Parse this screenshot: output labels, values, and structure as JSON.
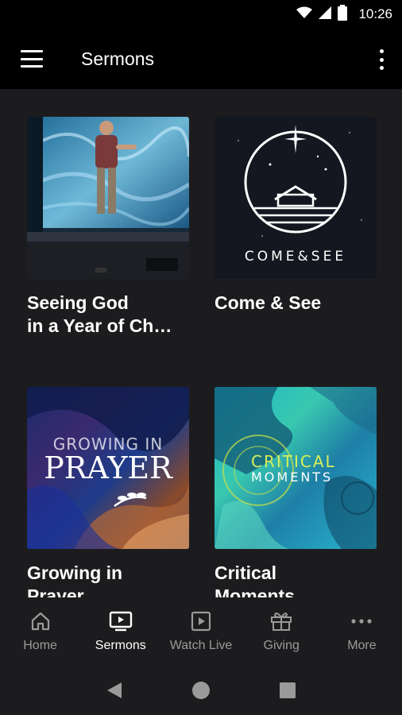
{
  "status_bar": {
    "time": "10:26",
    "icons": [
      "wifi-icon",
      "signal-icon",
      "battery-icon"
    ]
  },
  "app_bar": {
    "title": "Sermons",
    "menu_icon": "hamburger-menu-icon",
    "overflow_icon": "more-vertical-icon"
  },
  "sermons": [
    {
      "title": "Seeing God in a Year of Ch…",
      "title_line1": "Seeing God",
      "title_line2": "in a Year of Ch…"
    },
    {
      "title": "Come & See",
      "title_line1": "Come & See",
      "title_line2": "",
      "artwork_text": "COME&SEE"
    },
    {
      "title": "Growing in Prayer",
      "title_line1": "Growing in",
      "title_line2": "Prayer",
      "artwork_text_top": "GROWING IN",
      "artwork_text_main": "PRAYER"
    },
    {
      "title": "Critical Moments",
      "title_line1": "Critical",
      "title_line2": "Moments",
      "artwork_text_top": "CRITICAL",
      "artwork_text_bottom": "MOMENTS"
    }
  ],
  "bottom_nav": {
    "items": [
      {
        "label": "Home",
        "icon": "home-icon",
        "active": false
      },
      {
        "label": "Sermons",
        "icon": "tv-icon",
        "active": true
      },
      {
        "label": "Watch Live",
        "icon": "play-square-icon",
        "active": false
      },
      {
        "label": "Giving",
        "icon": "gift-icon",
        "active": false
      },
      {
        "label": "More",
        "icon": "more-horizontal-icon",
        "active": false
      }
    ]
  },
  "system_nav": {
    "icons": [
      "back-icon",
      "home-circle-icon",
      "recents-icon"
    ]
  },
  "colors": {
    "background": "#1c1c1e",
    "app_bar": "#000000",
    "active_label": "#ffffff",
    "inactive_label": "#9a9a9a"
  }
}
